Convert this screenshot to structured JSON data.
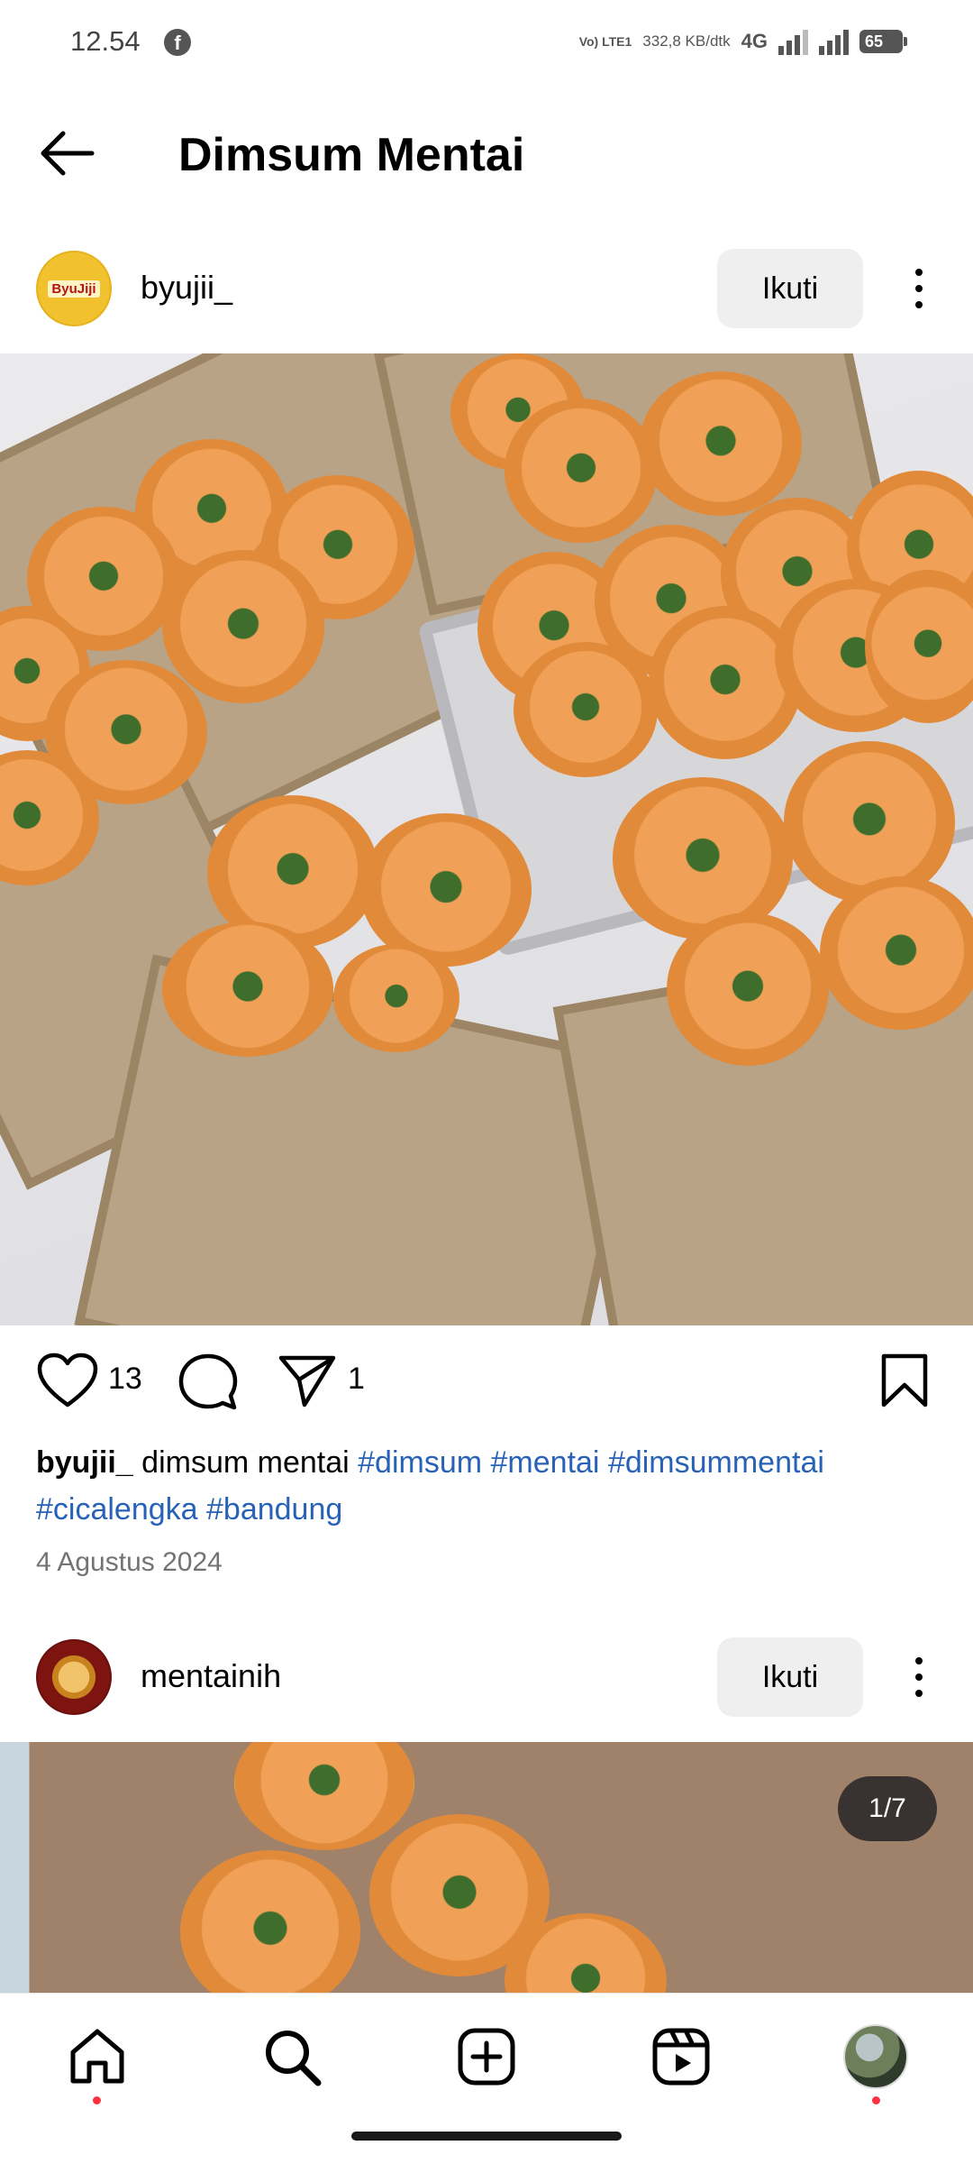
{
  "status_bar": {
    "time": "12.54",
    "volte": "Vo) LTE1",
    "speed": "332,8 KB/dtk",
    "network": "4G",
    "battery": "65"
  },
  "header": {
    "title": "Dimsum Mentai"
  },
  "posts": [
    {
      "username": "byujii_",
      "follow_label": "Ikuti",
      "likes": "13",
      "shares": "1",
      "caption_user": "byujii_",
      "caption_text": "dimsum mentai",
      "hashtags": [
        "#dimsum",
        "#mentai",
        "#dimsummentai",
        "#cicalengka",
        "#bandung"
      ],
      "date": "4 Agustus 2024"
    },
    {
      "username": "mentainih",
      "follow_label": "Ikuti",
      "image_counter": "1/7"
    }
  ],
  "icons": {
    "back": "arrow-left-icon",
    "like": "heart-icon",
    "comment": "comment-icon",
    "share": "send-icon",
    "save": "bookmark-icon",
    "more": "more-vertical-icon",
    "nav": [
      "home-icon",
      "search-icon",
      "add-post-icon",
      "reels-icon",
      "profile-avatar"
    ]
  },
  "colors": {
    "hashtag": "#2862b8",
    "notification_dot": "#ff3040",
    "follow_bg": "#efefef"
  }
}
